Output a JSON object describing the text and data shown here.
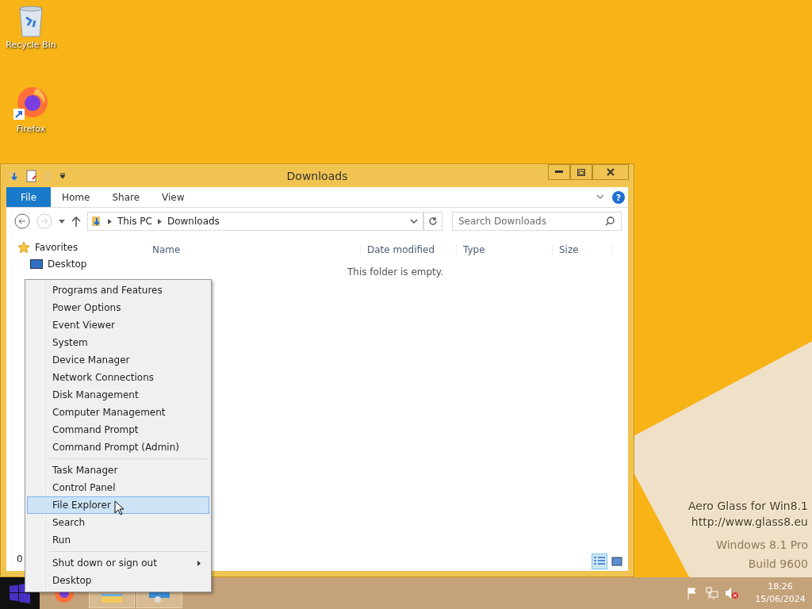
{
  "desktop": {
    "icons": [
      {
        "label": "Recycle Bin",
        "kind": "recycle-bin"
      },
      {
        "label": "Firefox",
        "kind": "firefox"
      }
    ],
    "aero_glass": [
      "Aero Glass for Win8.1",
      "http://www.glass8.eu"
    ],
    "os_watermark": [
      "Windows 8.1 Pro",
      "Build 9600"
    ]
  },
  "window": {
    "title": "Downloads",
    "file_tab": "File",
    "ribbon_tabs": [
      "Home",
      "Share",
      "View"
    ],
    "help_icon": "?",
    "breadcrumb": [
      "This PC",
      "Downloads"
    ],
    "search": {
      "placeholder": "Search Downloads"
    },
    "nav": [
      {
        "label": "Favorites",
        "kind": "favorites"
      },
      {
        "label": "Desktop",
        "kind": "desktop"
      }
    ],
    "columns": [
      "Name",
      "Date modified",
      "Type",
      "Size"
    ],
    "empty_message": "This folder is empty.",
    "status": "0",
    "views": [
      {
        "kind": "details",
        "selected": true
      },
      {
        "kind": "large-icons",
        "selected": false
      }
    ]
  },
  "context_menu": {
    "groups": [
      [
        {
          "label": "Programs and Features",
          "selected": false,
          "submenu": false
        },
        {
          "label": "Power Options",
          "selected": false,
          "submenu": false
        },
        {
          "label": "Event Viewer",
          "selected": false,
          "submenu": false
        },
        {
          "label": "System",
          "selected": false,
          "submenu": false
        },
        {
          "label": "Device Manager",
          "selected": false,
          "submenu": false
        },
        {
          "label": "Network Connections",
          "selected": false,
          "submenu": false
        },
        {
          "label": "Disk Management",
          "selected": false,
          "submenu": false
        },
        {
          "label": "Computer Management",
          "selected": false,
          "submenu": false
        },
        {
          "label": "Command Prompt",
          "selected": false,
          "submenu": false
        },
        {
          "label": "Command Prompt (Admin)",
          "selected": false,
          "submenu": false
        }
      ],
      [
        {
          "label": "Task Manager",
          "selected": false,
          "submenu": false
        },
        {
          "label": "Control Panel",
          "selected": false,
          "submenu": false
        },
        {
          "label": "File Explorer",
          "selected": true,
          "submenu": false
        },
        {
          "label": "Search",
          "selected": false,
          "submenu": false
        },
        {
          "label": "Run",
          "selected": false,
          "submenu": false
        }
      ],
      [
        {
          "label": "Shut down or sign out",
          "selected": false,
          "submenu": true
        },
        {
          "label": "Desktop",
          "selected": false,
          "submenu": false
        }
      ]
    ]
  },
  "taskbar": {
    "apps": [
      {
        "kind": "firefox",
        "running": false
      },
      {
        "kind": "explorer",
        "running": true
      },
      {
        "kind": "control-panel",
        "running": true
      }
    ],
    "time": "18:26",
    "date": "15/06/2024"
  }
}
